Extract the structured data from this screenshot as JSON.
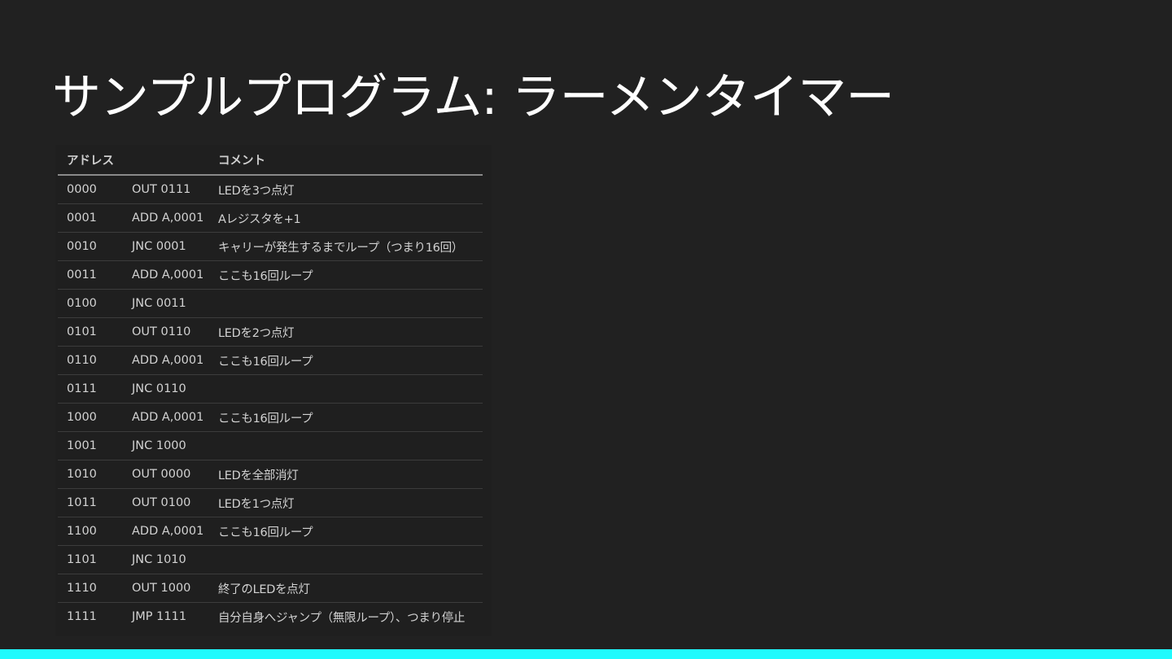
{
  "slide": {
    "title": "サンプルプログラム: ラーメンタイマー"
  },
  "table": {
    "headers": {
      "address": "アドレス",
      "instruction": "",
      "comment": "コメント"
    },
    "rows": [
      {
        "address": "0000",
        "instruction": "OUT 0111",
        "comment": "LEDを3つ点灯"
      },
      {
        "address": "0001",
        "instruction": "ADD A,0001",
        "comment": "Aレジスタを+1"
      },
      {
        "address": "0010",
        "instruction": "JNC 0001",
        "comment": "キャリーが発生するまでループ（つまり16回）"
      },
      {
        "address": "0011",
        "instruction": "ADD A,0001",
        "comment": "ここも16回ループ"
      },
      {
        "address": "0100",
        "instruction": "JNC 0011",
        "comment": ""
      },
      {
        "address": "0101",
        "instruction": "OUT 0110",
        "comment": "LEDを2つ点灯"
      },
      {
        "address": "0110",
        "instruction": "ADD A,0001",
        "comment": "ここも16回ループ"
      },
      {
        "address": "0111",
        "instruction": "JNC 0110",
        "comment": ""
      },
      {
        "address": "1000",
        "instruction": "ADD A,0001",
        "comment": "ここも16回ループ"
      },
      {
        "address": "1001",
        "instruction": "JNC 1000",
        "comment": ""
      },
      {
        "address": "1010",
        "instruction": "OUT 0000",
        "comment": "LEDを全部消灯"
      },
      {
        "address": "1011",
        "instruction": "OUT 0100",
        "comment": "LEDを1つ点灯"
      },
      {
        "address": "1100",
        "instruction": "ADD A,0001",
        "comment": "ここも16回ループ"
      },
      {
        "address": "1101",
        "instruction": "JNC 1010",
        "comment": ""
      },
      {
        "address": "1110",
        "instruction": "OUT 1000",
        "comment": "終了のLEDを点灯"
      },
      {
        "address": "1111",
        "instruction": "JMP 1111",
        "comment": "自分自身へジャンプ（無限ループ）、つまり停止"
      }
    ]
  },
  "colors": {
    "background": "#212121",
    "table_background": "#1f1f1f",
    "accent_bar": "#1ffafd"
  }
}
